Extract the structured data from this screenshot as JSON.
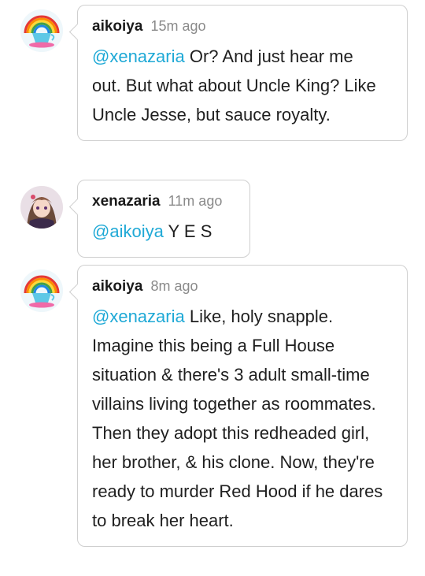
{
  "colors": {
    "mention": "#1fa9d6",
    "border": "#cfcfcf",
    "time": "#8a8a8a"
  },
  "replies": [
    {
      "avatar": "rainbow-teacup-avatar",
      "username": "aikoiya",
      "time": "15m ago",
      "mention": "@xenazaria",
      "text": " Or? And just hear me out. But what about Uncle King? Like Uncle Jesse, but sauce royalty."
    },
    {
      "avatar": "anime-character-avatar",
      "username": "xenazaria",
      "time": "11m ago",
      "mention": "@aikoiya",
      "text": " Y E S"
    },
    {
      "avatar": "rainbow-teacup-avatar",
      "username": "aikoiya",
      "time": "8m ago",
      "mention": "@xenazaria",
      "text": " Like, holy snapple. Imagine this being a Full House situation & there's 3 adult small-time villains living together as roommates. Then they adopt this redheaded girl, her brother, & his clone. Now, they're ready to murder Red Hood if he dares to break her heart."
    }
  ]
}
